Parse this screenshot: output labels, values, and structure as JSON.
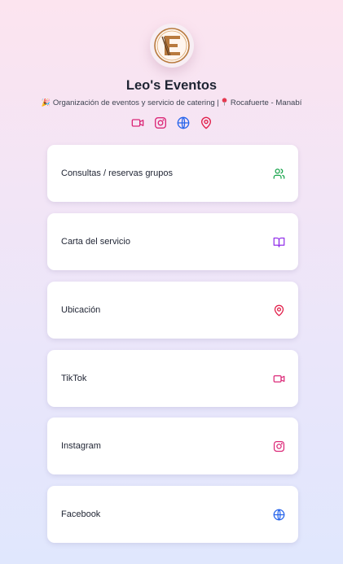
{
  "profile": {
    "name": "Leo's Eventos",
    "subtitle_emoji": "🎉",
    "subtitle_text": "Organización de eventos y servicio de catering |",
    "location": "Rocafuerte - Manabí"
  },
  "socials": [
    {
      "icon": "video-icon",
      "color": "#db2777"
    },
    {
      "icon": "instagram-icon",
      "color": "#db2777"
    },
    {
      "icon": "globe-icon",
      "color": "#2563eb"
    },
    {
      "icon": "map-pin-icon",
      "color": "#e11d48"
    }
  ],
  "links": [
    {
      "label": "Consultas / reservas grupos",
      "icon": "users-icon",
      "color": "#16a34a"
    },
    {
      "label": "Carta del servicio",
      "icon": "book-open-icon",
      "color": "#9333ea"
    },
    {
      "label": "Ubicación",
      "icon": "map-pin-icon",
      "color": "#e11d48"
    },
    {
      "label": "TikTok",
      "icon": "video-icon",
      "color": "#db2777"
    },
    {
      "label": "Instagram",
      "icon": "instagram-icon",
      "color": "#db2777"
    },
    {
      "label": "Facebook",
      "icon": "globe-icon",
      "color": "#2563eb"
    }
  ]
}
